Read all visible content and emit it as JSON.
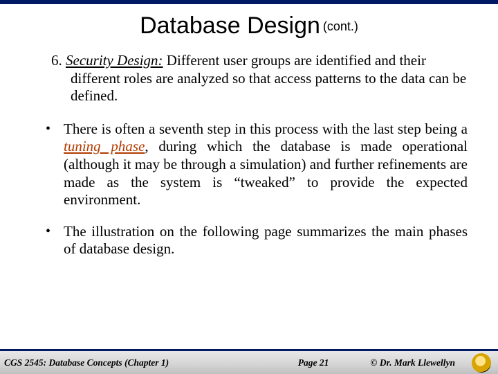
{
  "title": {
    "main": "Database Design",
    "cont": "(cont.)"
  },
  "numbered": {
    "num": "6.",
    "label": "Security Design:",
    "rest": "  Different user groups are identified and their different roles are analyzed so that access patterns to the data can be defined."
  },
  "bullets": [
    {
      "pre": "There is often a seventh step in this process with the last step being a ",
      "em": "tuning phase",
      "post": ", during which the database is made operational (although it may be through a simulation) and further refinements are made as the system is “tweaked” to provide the expected environment."
    },
    {
      "pre": "The illustration on the following page summarizes the main phases of database design.",
      "em": "",
      "post": ""
    }
  ],
  "footer": {
    "course": "CGS 2545: Database Concepts  (Chapter 1)",
    "page": "Page 21",
    "author": "© Dr. Mark Llewellyn"
  }
}
